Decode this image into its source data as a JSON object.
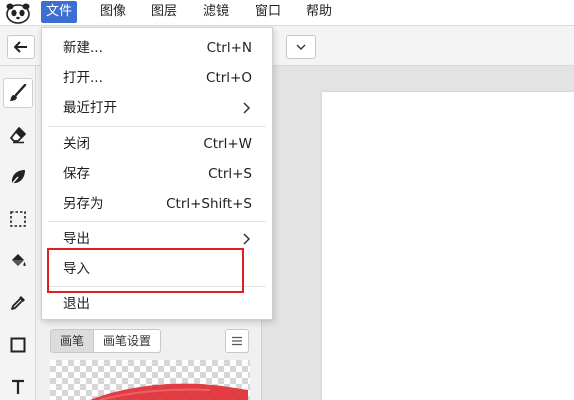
{
  "menubar": {
    "items": [
      {
        "label": "文件",
        "active": true
      },
      {
        "label": "图像"
      },
      {
        "label": "图层"
      },
      {
        "label": "滤镜"
      },
      {
        "label": "窗口"
      },
      {
        "label": "帮助"
      }
    ]
  },
  "file_menu": {
    "items": [
      {
        "label": "新建...",
        "shortcut": "Ctrl+N"
      },
      {
        "label": "打开...",
        "shortcut": "Ctrl+O"
      },
      {
        "label": "最近打开",
        "submenu": true
      },
      {
        "label": "关闭",
        "shortcut": "Ctrl+W"
      },
      {
        "label": "保存",
        "shortcut": "Ctrl+S"
      },
      {
        "label": "另存为",
        "shortcut": "Ctrl+Shift+S"
      },
      {
        "label": "导出",
        "submenu": true
      },
      {
        "label": "导入",
        "highlighted": true
      },
      {
        "label": "退出"
      }
    ]
  },
  "brush_panel": {
    "tabs": [
      "画笔",
      "画笔设置"
    ],
    "active_tab": "画笔"
  },
  "toolbar": {
    "tools": [
      "brush-icon",
      "eraser-icon",
      "leaf-icon",
      "marquee-select-icon",
      "paint-bucket-icon",
      "eyedropper-icon",
      "rectangle-icon",
      "text-icon"
    ],
    "selected": "brush-icon"
  },
  "colors": {
    "accent": "#3d6fd3",
    "highlight_box": "#e02020",
    "brush_stroke": "#e0343a"
  }
}
